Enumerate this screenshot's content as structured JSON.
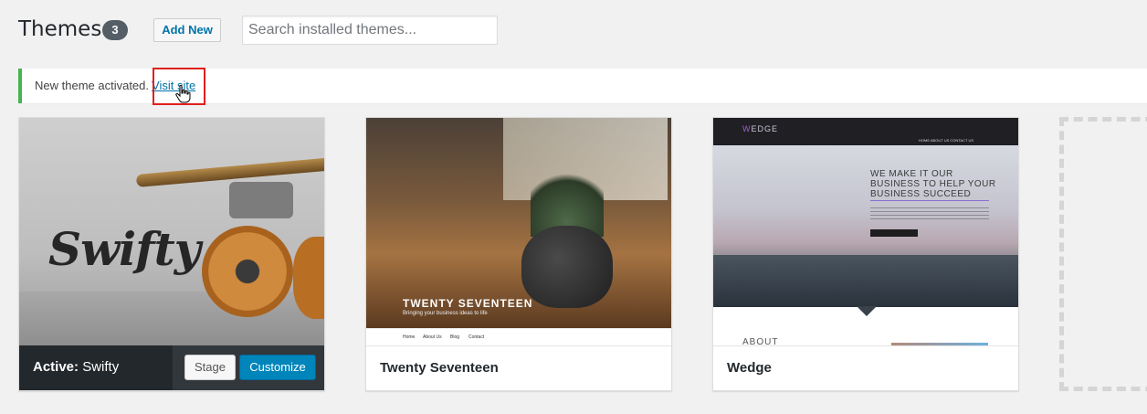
{
  "header": {
    "title": "Themes",
    "count": "3",
    "add_new_label": "Add New",
    "search_placeholder": "Search installed themes..."
  },
  "notice": {
    "text": "New theme activated.",
    "link_label": "Visit site",
    "accent_color": "#46b450"
  },
  "themes": [
    {
      "name": "Swifty",
      "active": true,
      "active_prefix": "Active:",
      "screenshot_logo": "Swifty",
      "actions": {
        "stage_label": "Stage",
        "customize_label": "Customize"
      }
    },
    {
      "name": "Twenty Seventeen",
      "active": false,
      "screenshot_title": "TWENTY SEVENTEEN",
      "screenshot_subtitle": "Bringing your business ideas to life",
      "screenshot_nav": [
        "Home",
        "About Us",
        "Blog",
        "Contact"
      ]
    },
    {
      "name": "Wedge",
      "active": false,
      "screenshot_logo_accent": "W",
      "screenshot_logo_rest": "EDGE",
      "screenshot_nav": "HOME   ABOUT US   CONTACT US",
      "screenshot_headline": [
        "WE MAKE IT OUR",
        "BUSINESS TO HELP YOUR",
        "BUSINESS SUCCEED"
      ],
      "screenshot_section": "ABOUT"
    }
  ],
  "colors": {
    "link": "#0073aa",
    "primary_button": "#0085ba",
    "active_bar": "#23282d",
    "highlight_box": "#e0201d"
  },
  "icons": {
    "cursor": "hand-pointer-icon",
    "add_theme": "add-theme-placeholder"
  }
}
